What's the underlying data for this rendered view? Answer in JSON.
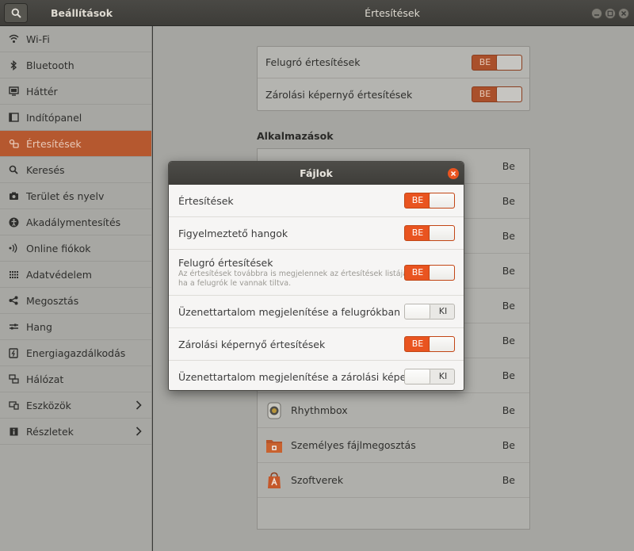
{
  "window": {
    "sidebar_title": "Beállítások",
    "main_title": "Értesítések"
  },
  "sidebar": {
    "items": [
      {
        "label": "Wi-Fi",
        "icon": "wifi-icon"
      },
      {
        "label": "Bluetooth",
        "icon": "bluetooth-icon"
      },
      {
        "label": "Háttér",
        "icon": "background-icon"
      },
      {
        "label": "Indítópanel",
        "icon": "dock-icon"
      },
      {
        "label": "Értesítések",
        "icon": "notifications-icon",
        "active": true
      },
      {
        "label": "Keresés",
        "icon": "search-icon"
      },
      {
        "label": "Terület és nyelv",
        "icon": "region-icon"
      },
      {
        "label": "Akadálymentesítés",
        "icon": "accessibility-icon"
      },
      {
        "label": "Online fiókok",
        "icon": "online-accounts-icon"
      },
      {
        "label": "Adatvédelem",
        "icon": "privacy-icon"
      },
      {
        "label": "Megosztás",
        "icon": "share-icon"
      },
      {
        "label": "Hang",
        "icon": "sound-icon"
      },
      {
        "label": "Energiagazdálkodás",
        "icon": "power-icon"
      },
      {
        "label": "Hálózat",
        "icon": "network-icon"
      },
      {
        "label": "Eszközök",
        "icon": "devices-icon",
        "has_chevron": true
      },
      {
        "label": "Részletek",
        "icon": "details-icon",
        "has_chevron": true
      }
    ]
  },
  "main": {
    "global": {
      "popup_label": "Felugró értesítések",
      "popup_state": "BE",
      "lock_label": "Zárolási képernyő értesítések",
      "lock_state": "BE"
    },
    "apps_title": "Alkalmazások",
    "apps": [
      {
        "name": "",
        "state": "Be"
      },
      {
        "name": "",
        "state": "Be"
      },
      {
        "name": "",
        "state": "Be"
      },
      {
        "name": "",
        "state": "Be"
      },
      {
        "name": "",
        "state": "Be"
      },
      {
        "name": "",
        "state": "Be"
      },
      {
        "name": "",
        "state": "Be"
      },
      {
        "name": "Rhythmbox",
        "state": "Be"
      },
      {
        "name": "Személyes fájlmegosztás",
        "state": "Be"
      },
      {
        "name": "Szoftverek",
        "state": "Be"
      }
    ]
  },
  "dialog": {
    "title": "Fájlok",
    "rows": [
      {
        "label": "Értesítések",
        "state": "BE",
        "on": true
      },
      {
        "label": "Figyelmeztető hangok",
        "state": "BE",
        "on": true
      },
      {
        "label": "Felugró értesítések",
        "sub1": "Az értesítések továbbra is megjelennek az értesítések listájában,",
        "sub2": "ha a felugrók le vannak tiltva.",
        "state": "BE",
        "on": true
      },
      {
        "label": "Üzenettartalom megjelenítése a felugrókban",
        "state": "KI",
        "on": false
      },
      {
        "label": "Zárolási képernyő értesítések",
        "state": "BE",
        "on": true
      },
      {
        "label": "Üzenettartalom megjelenítése a zárolási képernyőn",
        "state": "KI",
        "on": false
      }
    ]
  },
  "colors": {
    "accent": "#e95420",
    "titlebar": "#3d3c38"
  }
}
